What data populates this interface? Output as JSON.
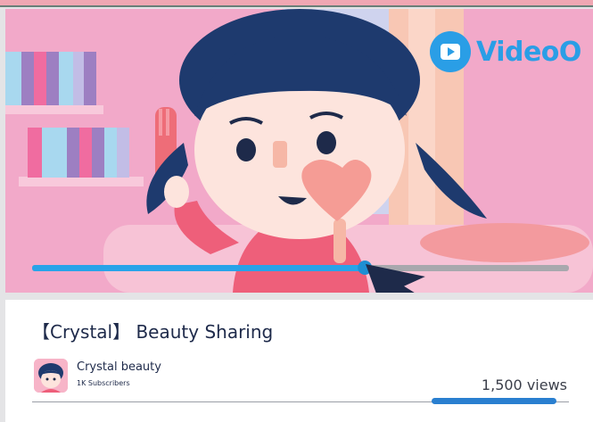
{
  "brand": {
    "name": "VideoO",
    "color": "#2a9ee6"
  },
  "player": {
    "progress": 0.62,
    "progress_color": "#29a3e8",
    "track_color": "#a8a8ad",
    "icons": [
      "play-icon",
      "cursor-arrow-icon"
    ]
  },
  "video": {
    "title": "【Crystal】 Beauty Sharing",
    "views": "1,500 views"
  },
  "channel": {
    "name": "Crystal beauty",
    "subscribers": "1K Subscribers"
  },
  "colors": {
    "background_pink": "#f2a9c9",
    "text_navy": "#1e2a4a",
    "hair_navy": "#1e3a6e",
    "skin": "#fde4dd"
  }
}
